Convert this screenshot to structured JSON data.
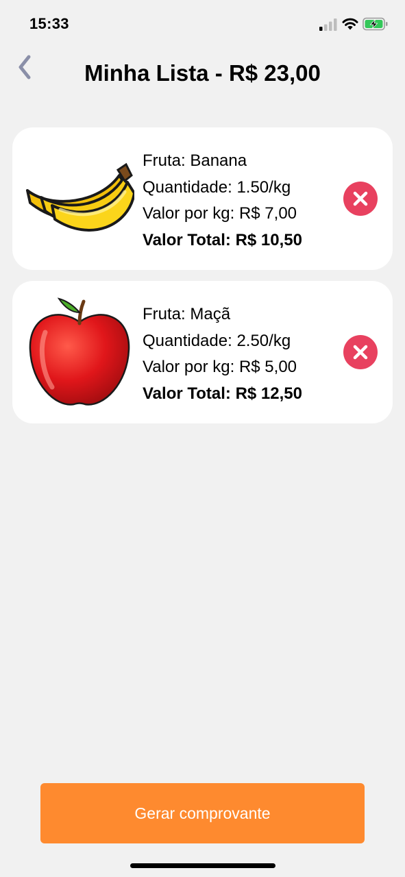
{
  "status_bar": {
    "time": "15:33",
    "signal_icon": "cellular-signal-icon",
    "wifi_icon": "wifi-icon",
    "battery_icon": "battery-charging-icon",
    "battery_color": "#34c759"
  },
  "header": {
    "back_icon": "chevron-left-icon",
    "title": "Minha Lista - R$ 23,00"
  },
  "items": [
    {
      "image_icon": "banana-icon",
      "fruit": "Fruta: Banana",
      "quantity": "Quantidade: 1.50/kg",
      "price_per_kg": "Valor por kg: R$ 7,00",
      "total": "Valor Total: R$ 10,50",
      "remove_icon": "close-circle-icon"
    },
    {
      "image_icon": "apple-icon",
      "fruit": "Fruta: Maçã",
      "quantity": "Quantidade: 2.50/kg",
      "price_per_kg": "Valor por kg: R$ 5,00",
      "total": "Valor Total: R$ 12,50",
      "remove_icon": "close-circle-icon"
    }
  ],
  "footer": {
    "button_label": "Gerar comprovante"
  },
  "colors": {
    "background": "#f1f1f1",
    "card": "#ffffff",
    "delete": "#e8415f",
    "primary_button": "#fe8a2f",
    "back_icon": "#8a8fa8"
  }
}
